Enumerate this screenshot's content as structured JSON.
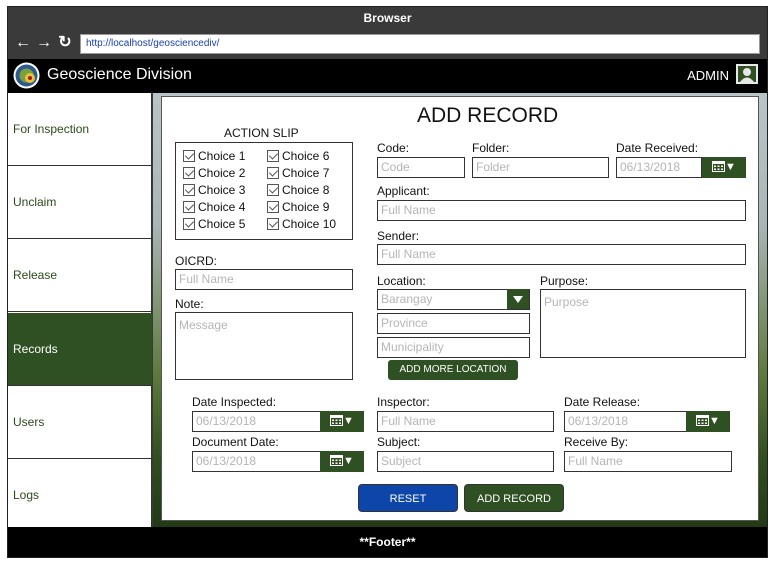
{
  "browser": {
    "title": "Browser",
    "url": "http://localhost/geosciencediv/"
  },
  "app": {
    "title": "Geoscience Division",
    "user": "ADMIN"
  },
  "sidebar": {
    "items": [
      {
        "label": "For Inspection"
      },
      {
        "label": "Unclaim"
      },
      {
        "label": "Release"
      },
      {
        "label": "Records",
        "active": true
      },
      {
        "label": "Users"
      },
      {
        "label": "Logs"
      }
    ]
  },
  "form": {
    "title": "ADD RECORD",
    "action_slip": {
      "label": "ACTION SLIP",
      "choices": [
        "Choice 1",
        "Choice 2",
        "Choice 3",
        "Choice 4",
        "Choice 5",
        "Choice 6",
        "Choice 7",
        "Choice 8",
        "Choice 9",
        "Choice 10"
      ]
    },
    "oicrd": {
      "label": "OICRD:",
      "placeholder": "Full Name"
    },
    "note": {
      "label": "Note:",
      "placeholder": "Message"
    },
    "code": {
      "label": "Code:",
      "placeholder": "Code"
    },
    "folder": {
      "label": "Folder:",
      "placeholder": "Folder"
    },
    "date_received": {
      "label": "Date Received:",
      "value": "06/13/2018"
    },
    "applicant": {
      "label": "Applicant:",
      "placeholder": "Full Name"
    },
    "sender": {
      "label": "Sender:",
      "placeholder": "Full Name"
    },
    "location": {
      "label": "Location:",
      "barangay_placeholder": "Barangay",
      "province_placeholder": "Province",
      "municipality_placeholder": "Municipality",
      "add_more_label": "ADD MORE LOCATION"
    },
    "purpose": {
      "label": "Purpose:",
      "placeholder": "Purpose"
    },
    "date_inspected": {
      "label": "Date Inspected:",
      "value": "06/13/2018"
    },
    "inspector": {
      "label": "Inspector:",
      "placeholder": "Full Name"
    },
    "date_release": {
      "label": "Date Release:",
      "value": "06/13/2018"
    },
    "document_date": {
      "label": "Document Date:",
      "value": "06/13/2018"
    },
    "subject": {
      "label": "Subject:",
      "placeholder": "Subject"
    },
    "receive_by": {
      "label": "Receive By:",
      "placeholder": "Full Name"
    },
    "reset_label": "RESET",
    "submit_label": "ADD RECORD"
  },
  "footer": {
    "text": "**Footer**"
  },
  "colors": {
    "accent_green": "#2f5022",
    "reset_blue": "#0d46a8",
    "header_black": "#000000"
  },
  "icons": {
    "back": "arrow-left-icon",
    "forward": "arrow-right-icon",
    "reload": "reload-icon",
    "logo": "agency-seal-logo",
    "user": "user-icon",
    "calendar": "calendar-icon",
    "dropdown": "chevron-down-icon",
    "checkbox": "checkbox-checked-icon"
  }
}
